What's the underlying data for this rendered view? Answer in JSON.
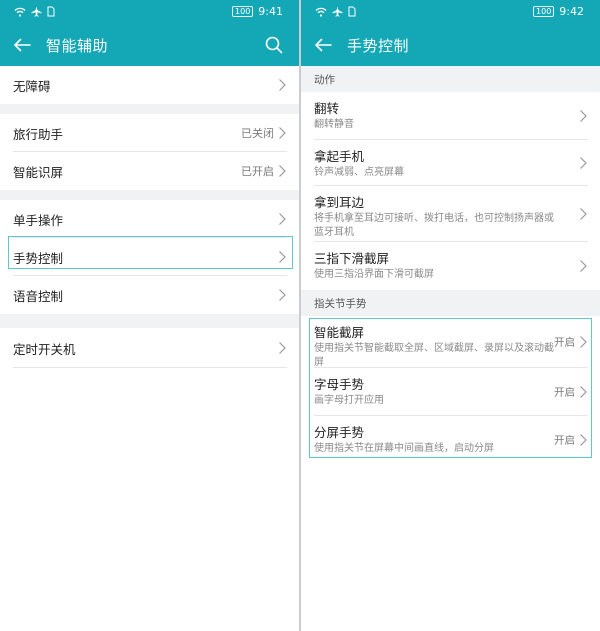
{
  "left": {
    "status": {
      "battery": "100",
      "time": "9:41"
    },
    "header": {
      "title": "智能辅助"
    },
    "groups": [
      {
        "items": [
          {
            "label": "无障碍",
            "value": ""
          }
        ]
      },
      {
        "items": [
          {
            "label": "旅行助手",
            "value": "已关闭"
          },
          {
            "label": "智能识屏",
            "value": "已开启"
          }
        ]
      },
      {
        "items": [
          {
            "label": "单手操作",
            "value": ""
          },
          {
            "label": "手势控制",
            "value": ""
          },
          {
            "label": "语音控制",
            "value": ""
          }
        ]
      },
      {
        "items": [
          {
            "label": "定时开关机",
            "value": ""
          }
        ]
      }
    ]
  },
  "right": {
    "status": {
      "battery": "100",
      "time": "9:42"
    },
    "header": {
      "title": "手势控制"
    },
    "sections": [
      {
        "title": "动作",
        "items": [
          {
            "title": "翻转",
            "subtitle": "翻转静音",
            "value": ""
          },
          {
            "title": "拿起手机",
            "subtitle": "铃声减弱、点亮屏幕",
            "value": ""
          },
          {
            "title": "拿到耳边",
            "subtitle": "将手机拿至耳边可接听、拨打电话，也可控制扬声器或蓝牙耳机",
            "value": ""
          },
          {
            "title": "三指下滑截屏",
            "subtitle": "使用三指沿界面下滑可截屏",
            "value": ""
          }
        ]
      },
      {
        "title": "指关节手势",
        "items": [
          {
            "title": "智能截屏",
            "subtitle": "使用指关节智能截取全屏、区域截屏、录屏以及滚动截屏",
            "value": "开启"
          },
          {
            "title": "字母手势",
            "subtitle": "画字母打开应用",
            "value": "开启"
          },
          {
            "title": "分屏手势",
            "subtitle": "使用指关节在屏幕中间画直线，启动分屏",
            "value": "开启"
          }
        ]
      }
    ]
  },
  "icons": [
    "wifi-icon",
    "airplane-icon",
    "sim-icon",
    "back-arrow-icon",
    "search-icon",
    "chevron-right-icon"
  ],
  "colors": {
    "header": "#14a8b7",
    "highlight": "#5ec7cf",
    "group_gap": "#f1f2f4"
  }
}
